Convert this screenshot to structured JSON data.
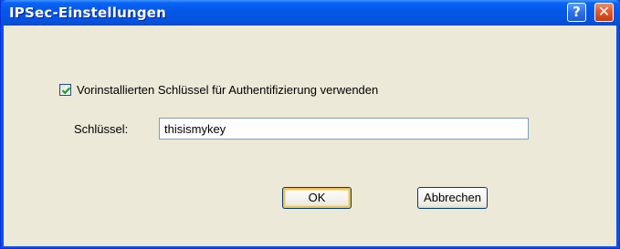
{
  "window": {
    "title": "IPSec-Einstellungen",
    "help_icon": "?",
    "close_icon": "✕"
  },
  "form": {
    "preshared_checkbox_label": "Vorinstallierten Schlüssel für Authentifizierung verwenden",
    "preshared_checked": true,
    "key_label": "Schlüssel:",
    "key_value": "thisismykey"
  },
  "buttons": {
    "ok_label": "OK",
    "cancel_label": "Abbrechen"
  },
  "colors": {
    "titlebar": "#0458e8",
    "client": "#ece9d8",
    "close_button": "#e25a2c",
    "check_mark": "#21a121"
  }
}
